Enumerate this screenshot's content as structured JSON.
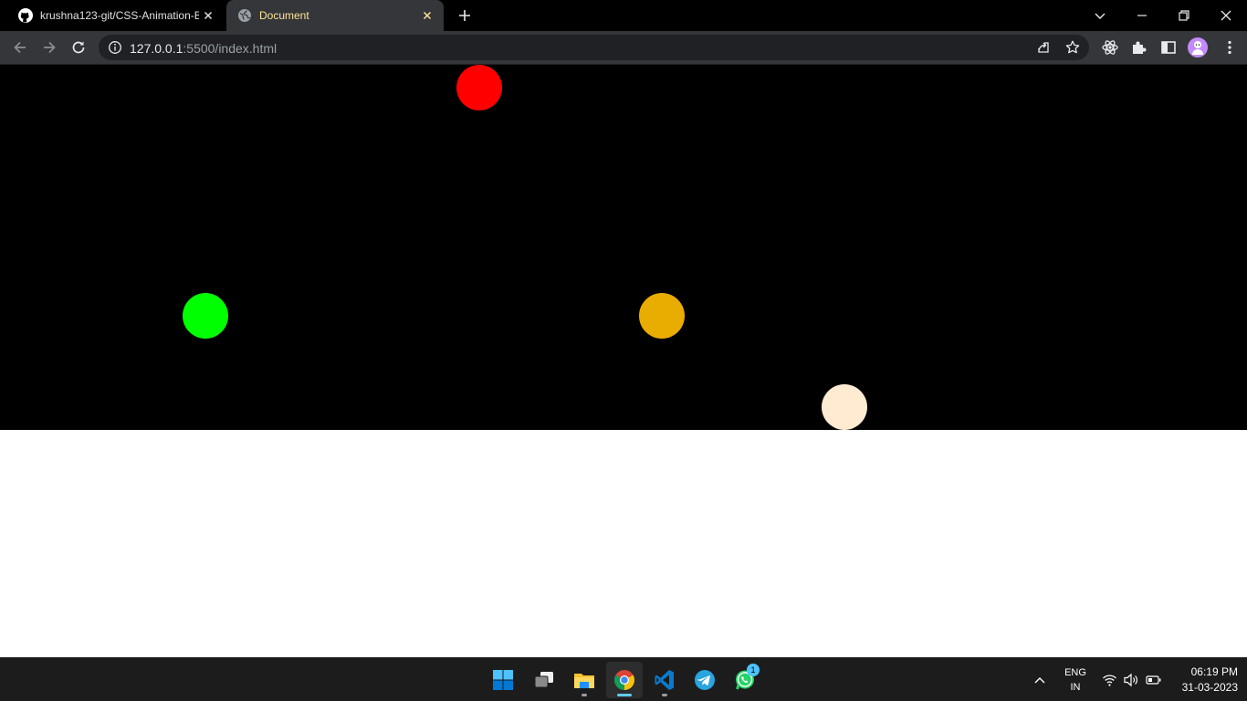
{
  "browser": {
    "tabs": [
      {
        "title": "krushna123-git/CSS-Animation-B",
        "icon": "github-icon",
        "active": false
      },
      {
        "title": "Document",
        "icon": "globe-icon",
        "active": true
      }
    ],
    "address_bar": {
      "host": "127.0.0.1",
      "rest": ":5500/index.html"
    }
  },
  "page": {
    "background": "#000000",
    "balls": [
      {
        "name": "red-ball",
        "color": "#ff0000"
      },
      {
        "name": "green-ball",
        "color": "#00ff00"
      },
      {
        "name": "orange-ball",
        "color": "#e9ac00"
      },
      {
        "name": "cream-ball",
        "color": "#ffebd2"
      }
    ]
  },
  "taskbar": {
    "apps": [
      {
        "name": "start-button",
        "icon": "windows-logo-icon"
      },
      {
        "name": "task-view-button",
        "icon": "task-view-icon"
      },
      {
        "name": "file-explorer-button",
        "icon": "folder-icon"
      },
      {
        "name": "chrome-button",
        "icon": "chrome-icon",
        "active": true
      },
      {
        "name": "vscode-button",
        "icon": "vscode-icon"
      },
      {
        "name": "telegram-button",
        "icon": "telegram-icon"
      },
      {
        "name": "whatsapp-button",
        "icon": "whatsapp-icon",
        "badge": "1"
      }
    ],
    "language": {
      "line1": "ENG",
      "line2": "IN"
    },
    "clock": {
      "time": "06:19 PM",
      "date": "31-03-2023"
    }
  }
}
